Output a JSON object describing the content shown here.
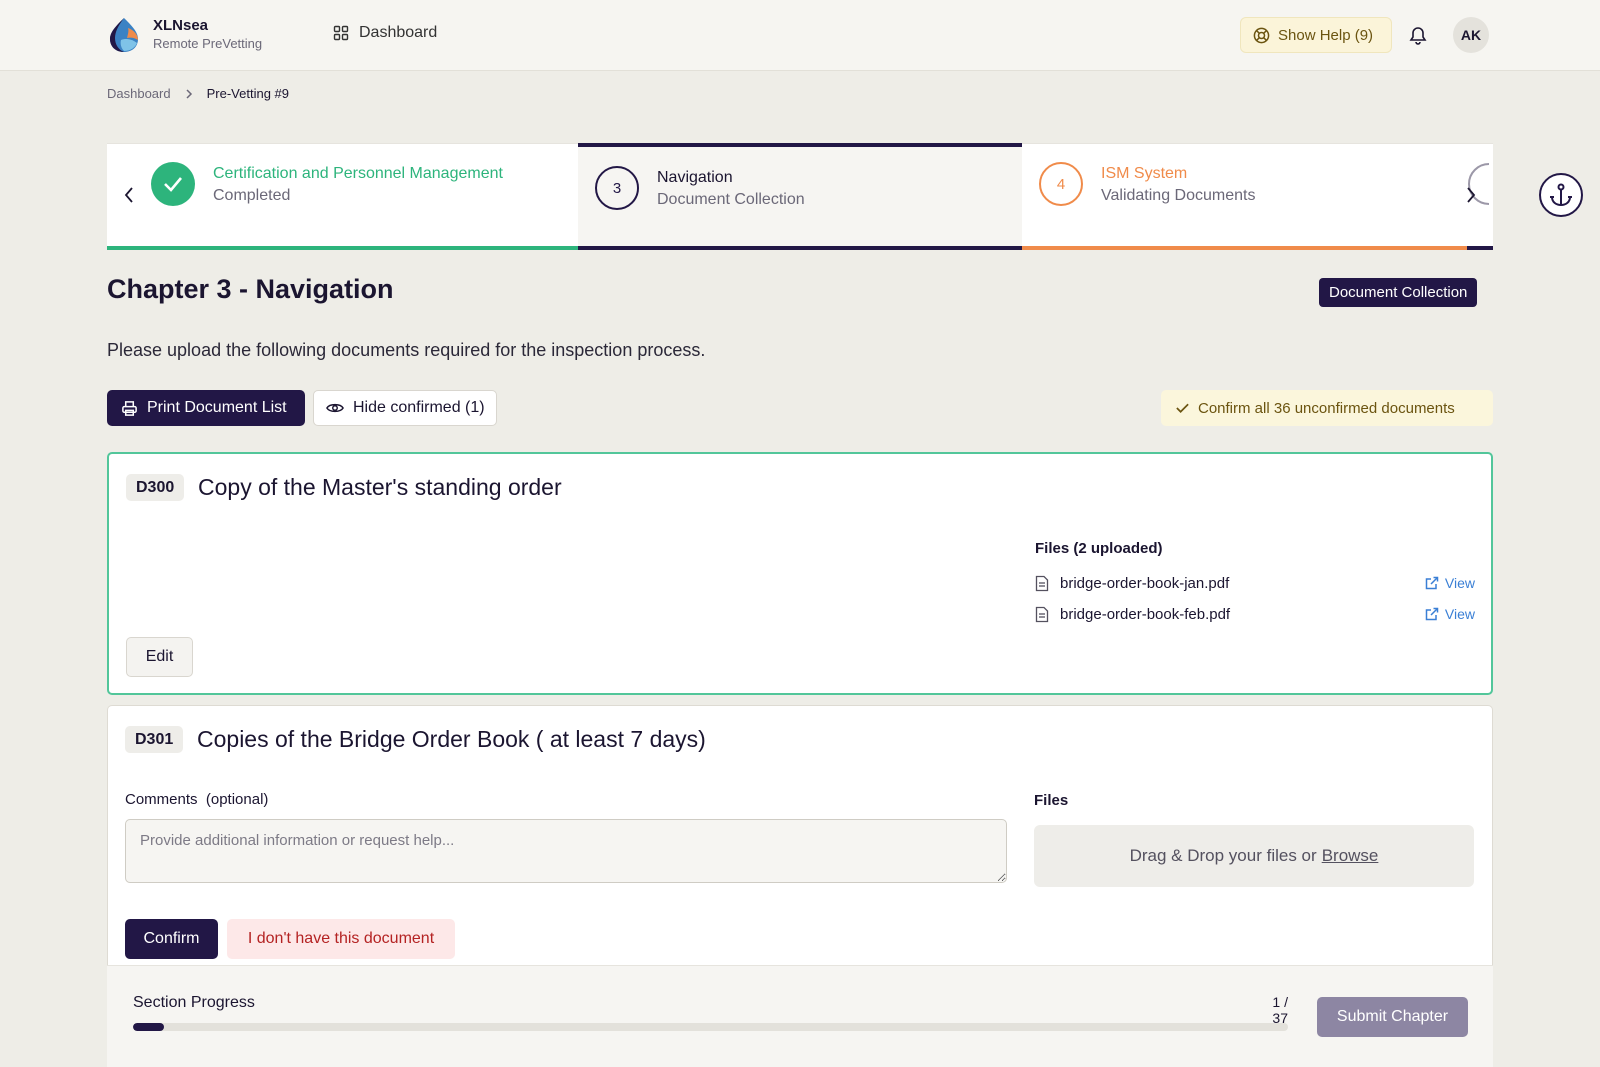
{
  "header": {
    "brand_name": "XLNsea",
    "brand_sub": "Remote PreVetting",
    "nav_dashboard": "Dashboard",
    "help_label": "Show Help (9)",
    "avatar_initials": "AK"
  },
  "breadcrumb": {
    "root": "Dashboard",
    "current": "Pre-Vetting #9"
  },
  "stepper": {
    "steps": [
      {
        "number": "",
        "title": "Certification and Personnel Management",
        "status": "Completed",
        "state": "done",
        "color": "#2db47c"
      },
      {
        "number": "3",
        "title": "Navigation",
        "status": "Document Collection",
        "state": "active",
        "color": "#221746"
      },
      {
        "number": "4",
        "title": "ISM System",
        "status": "Validating Documents",
        "state": "pending",
        "color": "#f08b4a"
      }
    ]
  },
  "main": {
    "title": "Chapter 3 - Navigation",
    "phase_badge": "Document Collection",
    "instructions": "Please upload the following documents required for the inspection process.",
    "print_button": "Print Document List",
    "hide_button": "Hide confirmed (1)",
    "confirm_all_button": "Confirm all 36 unconfirmed documents"
  },
  "documents": [
    {
      "code": "D300",
      "title": "Copy of the Master's standing order",
      "files_heading": "Files (2 uploaded)",
      "files": [
        {
          "name": "bridge-order-book-jan.pdf",
          "action": "View"
        },
        {
          "name": "bridge-order-book-feb.pdf",
          "action": "View"
        }
      ],
      "edit_button": "Edit"
    },
    {
      "code": "D301",
      "title": "Copies of the Bridge Order Book ( at least 7 days)",
      "comments_label": "Comments",
      "comments_optional": "(optional)",
      "comments_placeholder": "Provide additional information or request help...",
      "files_heading": "Files",
      "dropzone_text": "Drag & Drop your files or",
      "dropzone_link": "Browse",
      "confirm_button": "Confirm",
      "no_doc_button": "I don't have this document"
    }
  ],
  "progress": {
    "label": "Section Progress",
    "count": "1 / 37",
    "fraction": 0.027,
    "submit_button": "Submit Chapter"
  },
  "colors": {
    "primary": "#221746",
    "success": "#2db47c",
    "warning": "#f08b4a",
    "link": "#3a7fd5"
  }
}
